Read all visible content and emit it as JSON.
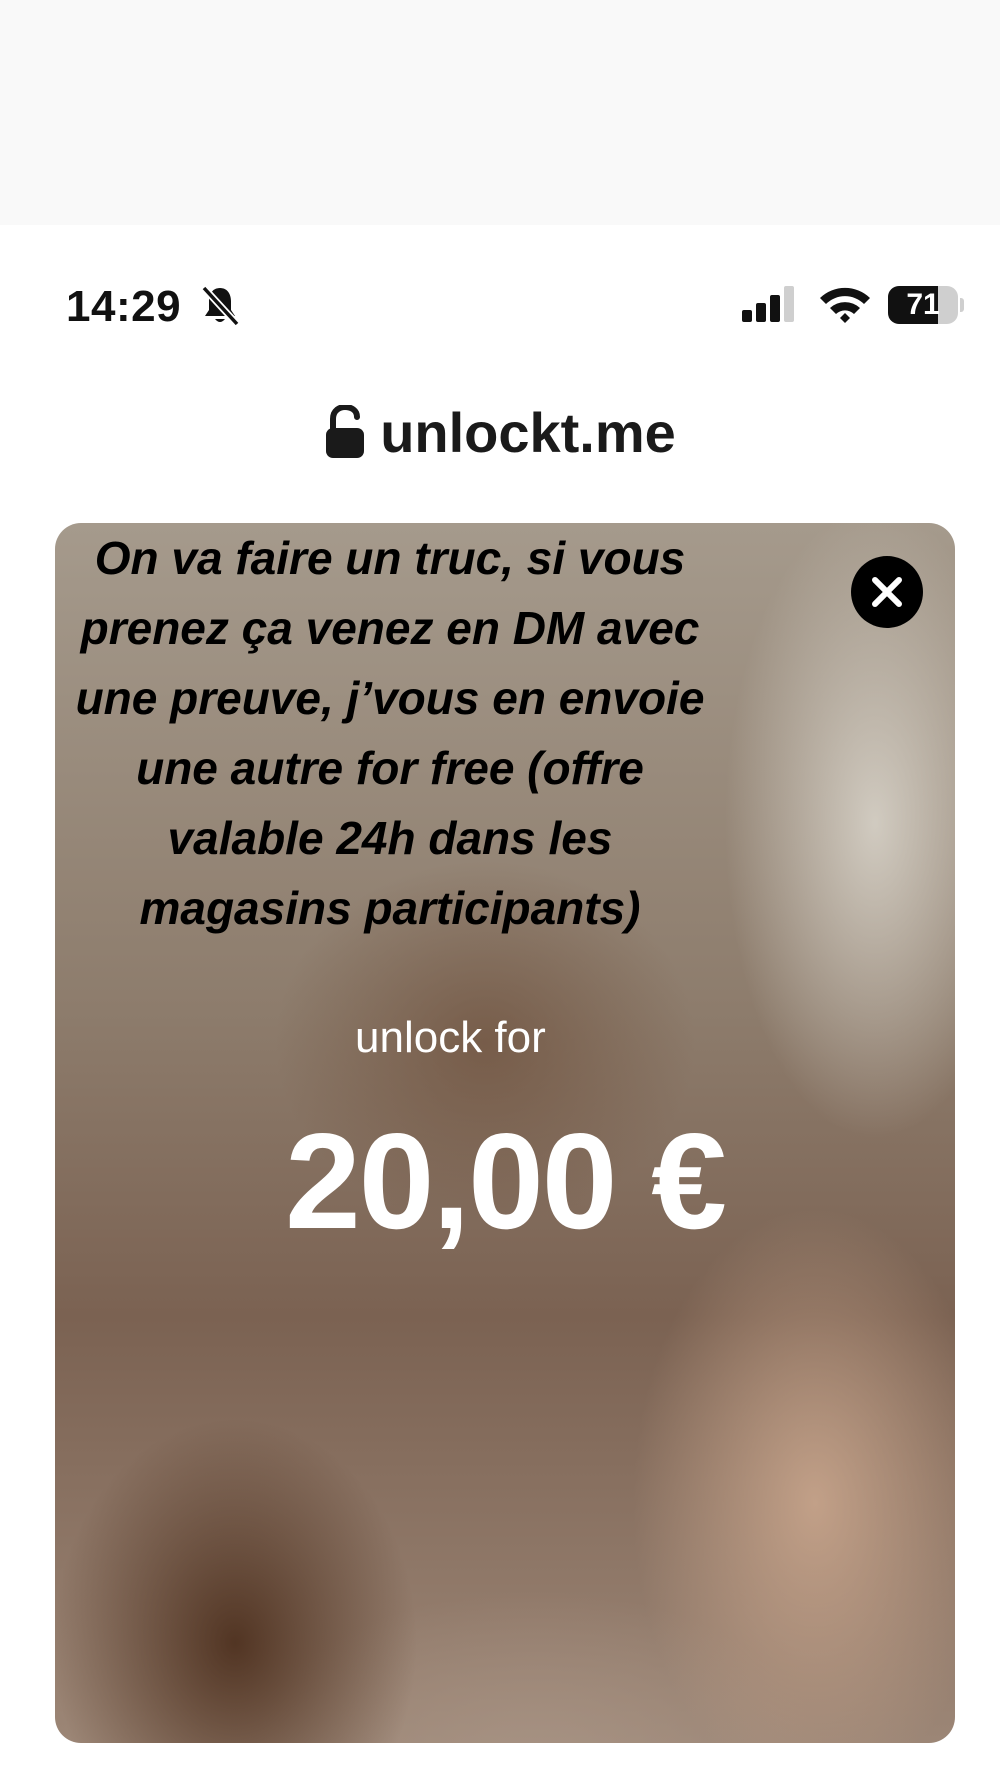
{
  "status_bar": {
    "time": "14:29",
    "battery": "71",
    "battery_level": 0.71,
    "icons": [
      "bell-slash-icon",
      "cellular-signal-icon",
      "wifi-icon",
      "battery-icon"
    ]
  },
  "browser": {
    "url": "unlockt.me",
    "icon": "lock-icon"
  },
  "card": {
    "message": "On va faire un truc, si vous prenez ça venez en DM avec une preuve, j’vous en envoie une autre for free (offre valable 24h dans les magasins participants)",
    "unlock_label": "unlock for",
    "price": "20,00 €",
    "close_icon": "close-icon"
  }
}
